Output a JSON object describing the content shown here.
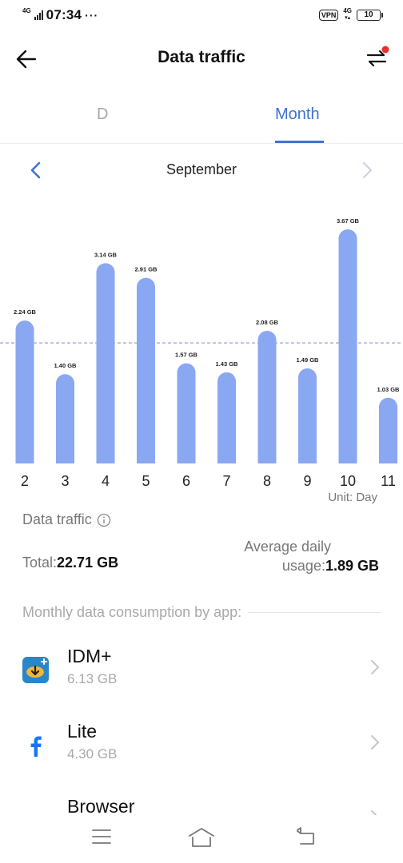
{
  "status_bar": {
    "network": "4G",
    "time": "07:34",
    "more": "···",
    "vpn": "VPN",
    "signal_4g": "4G",
    "battery": "10"
  },
  "header": {
    "title": "Data traffic"
  },
  "tabs": {
    "day": "D",
    "month": "Month",
    "selected": "month"
  },
  "month_nav": {
    "label": "September"
  },
  "chart_data": {
    "type": "bar",
    "categories": [
      "2",
      "3",
      "4",
      "5",
      "6",
      "7",
      "8",
      "9",
      "10",
      "11"
    ],
    "values": [
      2.24,
      1.4,
      3.14,
      2.91,
      1.57,
      1.43,
      2.08,
      1.49,
      3.67,
      1.03
    ],
    "data_labels": [
      "2.24 GB",
      "1.40 GB",
      "3.14 GB",
      "2.91 GB",
      "1.57 GB",
      "1.43 GB",
      "2.08 GB",
      "1.49 GB",
      "3.67 GB",
      "1.03 GB"
    ],
    "average_line": 1.89,
    "ylim": [
      0,
      3.67
    ],
    "bar_color": "#8aa7f2",
    "average_line_color": "#8fa6c4"
  },
  "chart_unit": "Unit: Day",
  "summary": {
    "section_label": "Data traffic",
    "total_label": "Total:",
    "total_value": "22.71 GB",
    "avg_label_1": "Average daily",
    "avg_label_2": "usage:",
    "avg_value": "1.89 GB"
  },
  "consumption_label": "Monthly data consumption by app:",
  "apps": [
    {
      "name": "IDM+",
      "size": "6.13 GB",
      "icon": "idm-download-icon"
    },
    {
      "name": "Lite",
      "size": "4.30 GB",
      "icon": "facebook-lite-icon"
    },
    {
      "name": "Browser",
      "size": "",
      "icon": "vivaldi-browser-icon"
    }
  ],
  "colors": {
    "accent": "#3f72d3",
    "muted_text": "#a9a9a9"
  }
}
